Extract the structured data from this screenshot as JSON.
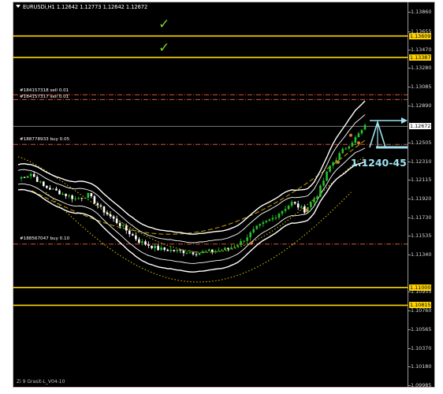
{
  "chart": {
    "symbol": "EURUSDi,H1",
    "ohlc": "1.12642 1.12773 1.12642 1.12672",
    "header_text": "EURUSDi,H1  1.12642 1.12773 1.12642 1.12672",
    "footer_text": "Zi 9 Grasit-L_V04-10",
    "annotation": "1.1240-45",
    "checkmark_glyph": "✓",
    "colors": {
      "background": "#000000",
      "horizontal_level": "#ffd400",
      "order_line": "#d9553a",
      "bullish_candle": "#27c32d",
      "bearish_candle": "#ffffff",
      "bollinger_outer": "#ffffff",
      "envelope_dash": "#c8a000",
      "envelope_dot": "#d8c800",
      "annotation": "#9fe4f2"
    }
  },
  "order_lines": [
    {
      "label": "#184157318 sell 0.01",
      "price": 1.13
    },
    {
      "label": "#184157317 sell 0.01",
      "price": 1.1295
    },
    {
      "label": "#188778933 buy 0.05",
      "price": 1.12485
    },
    {
      "label": "#188567047 buy 0.10",
      "price": 1.1145
    }
  ],
  "price_axis": {
    "ticks": [
      "1.13860",
      "1.13655",
      "1.13470",
      "1.13280",
      "1.13085",
      "1.12890",
      "1.12505",
      "1.12310",
      "1.12115",
      "1.11920",
      "1.11730",
      "1.11535",
      "1.11340",
      "1.10955",
      "1.10760",
      "1.10565",
      "1.10370",
      "1.10180",
      "1.09985"
    ],
    "tagged": [
      {
        "text": "1.13609",
        "style": "yellow"
      },
      {
        "text": "1.13387",
        "style": "yellow"
      },
      {
        "text": "1.12672",
        "style": "white"
      },
      {
        "text": "1.11000",
        "style": "yellow"
      },
      {
        "text": "1.10815",
        "style": "yellow"
      }
    ]
  },
  "levels": [
    1.13609,
    1.13387,
    1.11,
    1.10815
  ]
}
